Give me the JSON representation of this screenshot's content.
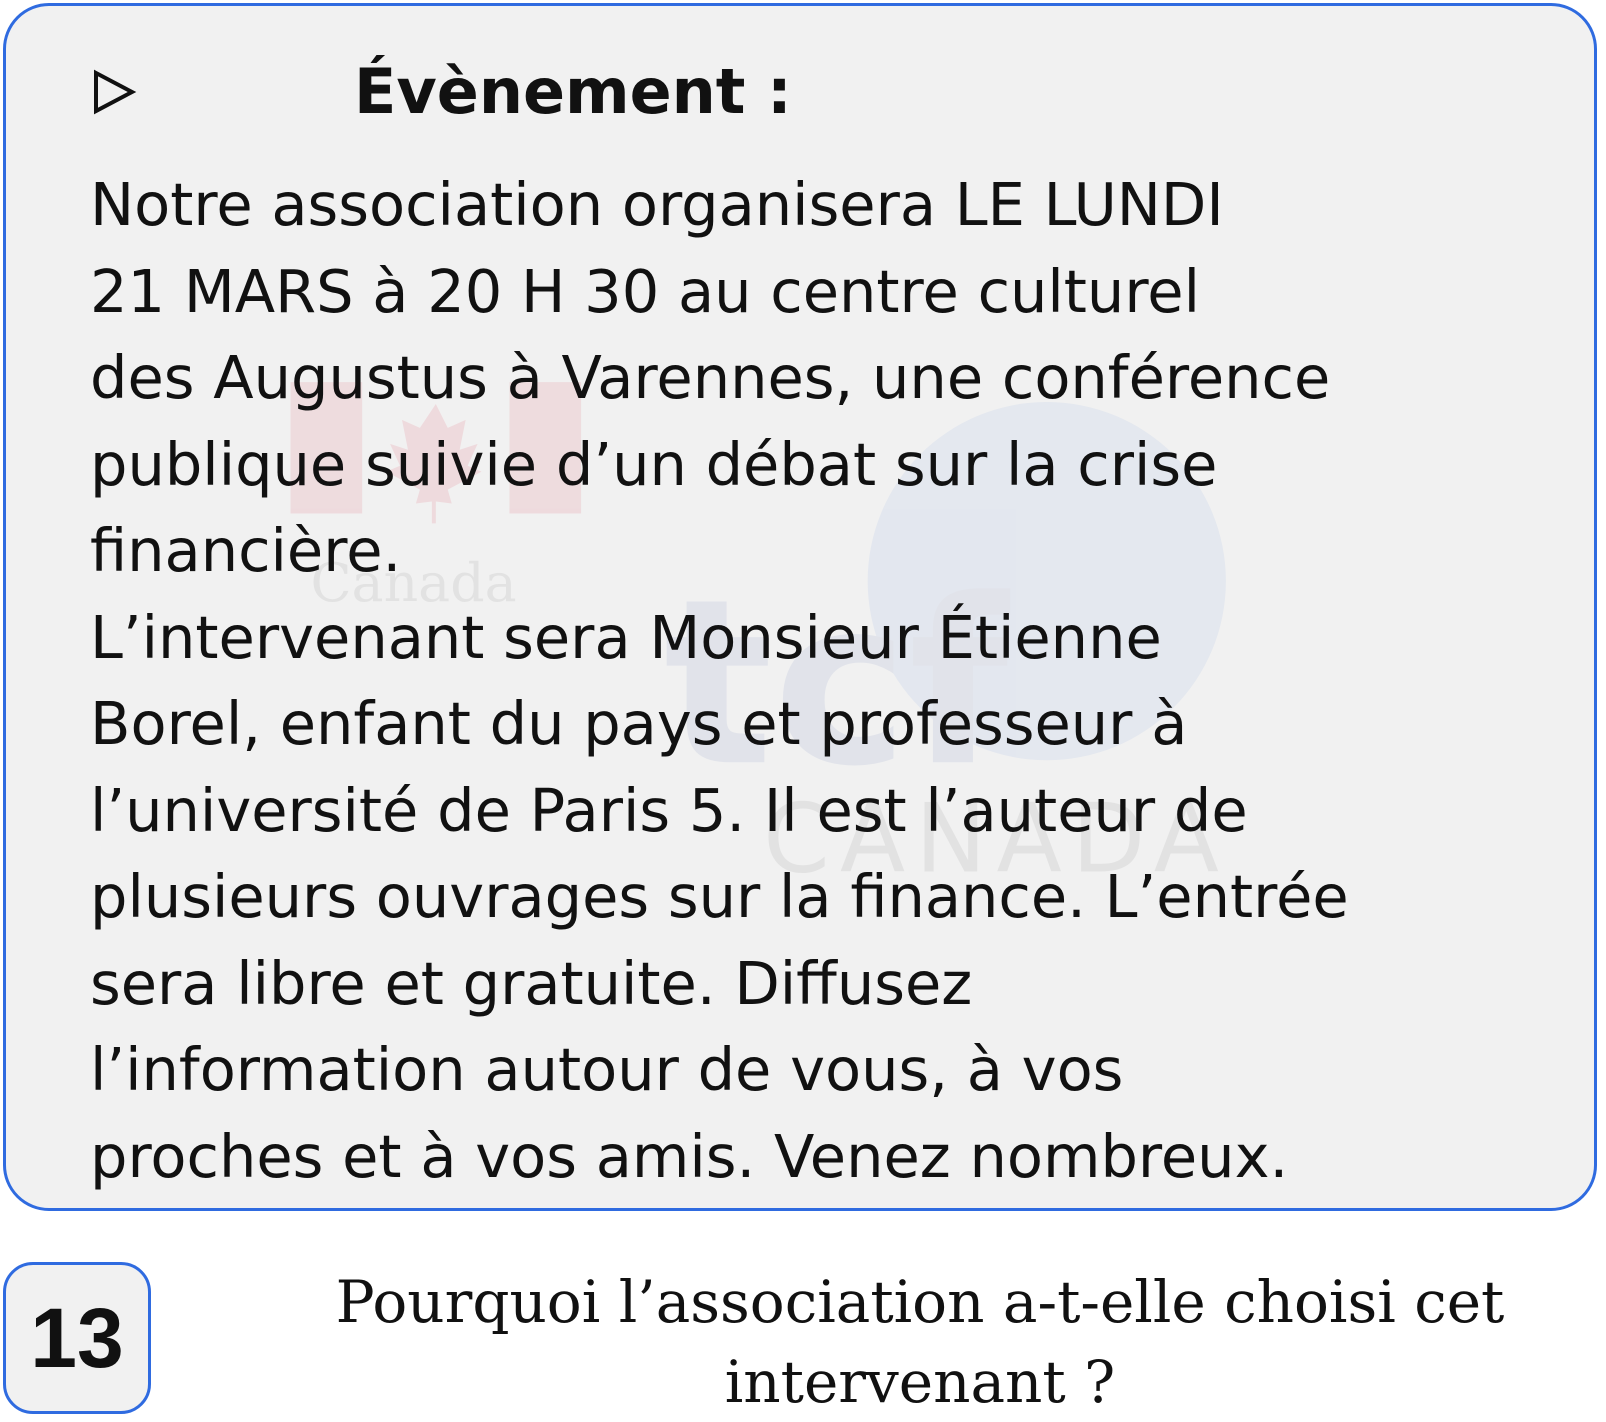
{
  "card": {
    "title": "Évènement :",
    "arrow_icon": "play-outline-icon",
    "body_lines": [
      "Notre association organisera LE LUNDI",
      "21 MARS à 20 H 30 au centre culturel",
      "des Augustus à Varennes, une conférence",
      "publique suivie d’un débat sur la crise",
      "financière.",
      "L’intervenant sera Monsieur Étienne",
      "Borel, enfant du pays et professeur à",
      "l’université de Paris 5. Il est l’auteur de",
      "plusieurs ouvrages sur la finance. L’entrée",
      "sera libre et gratuite. Diffusez",
      "l’information autour de vous, à vos",
      "proches et à vos amis. Venez nombreux."
    ],
    "watermark": {
      "left_logo_text": "Canada",
      "right_logo_text": "tcf",
      "right_logo_subtext": "CANADA"
    }
  },
  "question": {
    "number": "13",
    "lines": [
      "Pourquoi l’association a-t-elle choisi cet",
      "intervenant ?"
    ]
  },
  "colors": {
    "border": "#2f6be0",
    "card_background": "#f1f1f1",
    "text": "#111111"
  }
}
